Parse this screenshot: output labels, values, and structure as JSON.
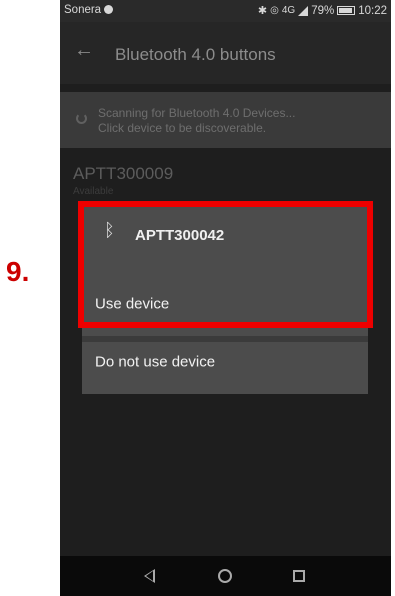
{
  "annotation": {
    "step_number": "9."
  },
  "status_bar": {
    "carrier": "Sonera",
    "network": "4G",
    "battery": "79%",
    "time": "10:22"
  },
  "app_bar": {
    "title": "Bluetooth 4.0 buttons"
  },
  "scanning": {
    "line1": "Scanning for Bluetooth 4.0 Devices...",
    "line2": "Click device to be discoverable."
  },
  "device_list": [
    {
      "name": "APTT300009",
      "status": "Available"
    }
  ],
  "dialog": {
    "device_name": "APTT300042",
    "options": {
      "use": "Use device",
      "not_use": "Do not use device"
    }
  },
  "colors": {
    "highlight": "#ee0000",
    "step_number": "#cc0000",
    "dialog_bg": "#4c4c4c",
    "screen_bg": "#1e1e1e"
  },
  "icons": {
    "status": [
      "bluetooth-icon",
      "alarm-icon",
      "signal-icon",
      "battery-icon"
    ],
    "nav": [
      "back-triangle-icon",
      "home-circle-icon",
      "recents-square-icon"
    ]
  }
}
